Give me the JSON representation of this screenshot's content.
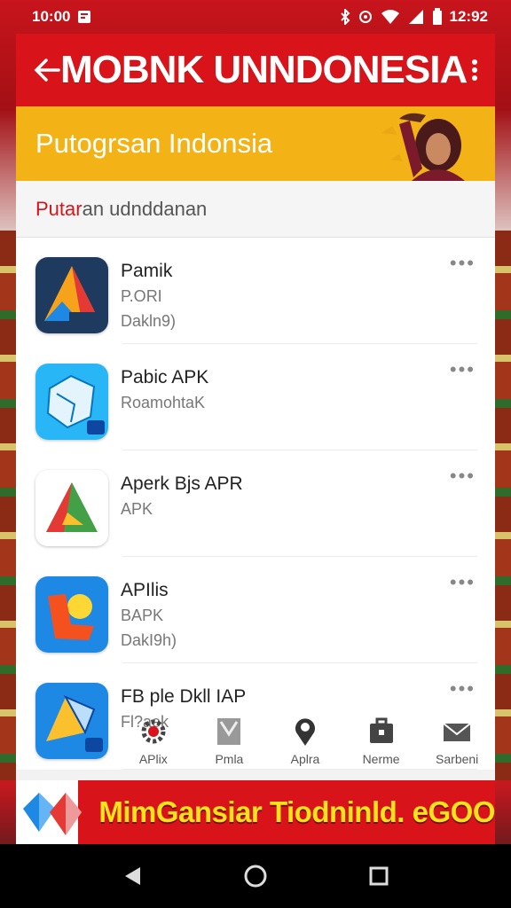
{
  "status_bar": {
    "time_left": "10:00",
    "time_right": "12:92"
  },
  "app_bar": {
    "title": "MOBNK UNNDONESIA"
  },
  "banner": {
    "text": "Putogrsan Indonsia"
  },
  "section": {
    "accent": "Putar",
    "rest": "an udnddanan"
  },
  "apps": [
    {
      "title": "Pamik",
      "line1": "P.ORI",
      "line2": "Dakln9)",
      "icon": "pamik-app-icon",
      "colors": [
        "#1e3a5f",
        "#f7a21b",
        "#e53935",
        "#1e88e5"
      ]
    },
    {
      "title": "Pabic APK",
      "line1": "RoamohtaK",
      "line2": "",
      "icon": "pabic-app-icon",
      "colors": [
        "#29b6f6",
        "#e3f4fd"
      ]
    },
    {
      "title": "Aperk Bjs APR",
      "line1": "APK",
      "line2": "",
      "icon": "aperk-app-icon",
      "colors": [
        "#ffffff",
        "#43a047",
        "#e53935",
        "#fbc02d"
      ]
    },
    {
      "title": "APIlis",
      "line1": "BAPK",
      "line2": "DakI9h)",
      "icon": "apilis-app-icon",
      "colors": [
        "#1e88e5",
        "#f4511e",
        "#fdd835"
      ]
    },
    {
      "title": "FB ple Dkll IAP",
      "line1": "Fl?aek",
      "line2": "",
      "icon": "fb-app-icon",
      "colors": [
        "#1e88e5",
        "#fbc02d"
      ]
    }
  ],
  "bottom_nav": [
    {
      "label": "APlix",
      "icon": "gear-icon"
    },
    {
      "label": "Pmla",
      "icon": "map-icon"
    },
    {
      "label": "Aplra",
      "icon": "location-pin-icon"
    },
    {
      "label": "Nerme",
      "icon": "briefcase-icon"
    },
    {
      "label": "Sarbeni",
      "icon": "mail-icon"
    }
  ],
  "promo": {
    "text": "MimGansiar Tiodninld. eGOO"
  },
  "colors": {
    "primary_red": "#d8141a",
    "banner_yellow": "#f3b316",
    "promo_text": "#ffe21a"
  }
}
